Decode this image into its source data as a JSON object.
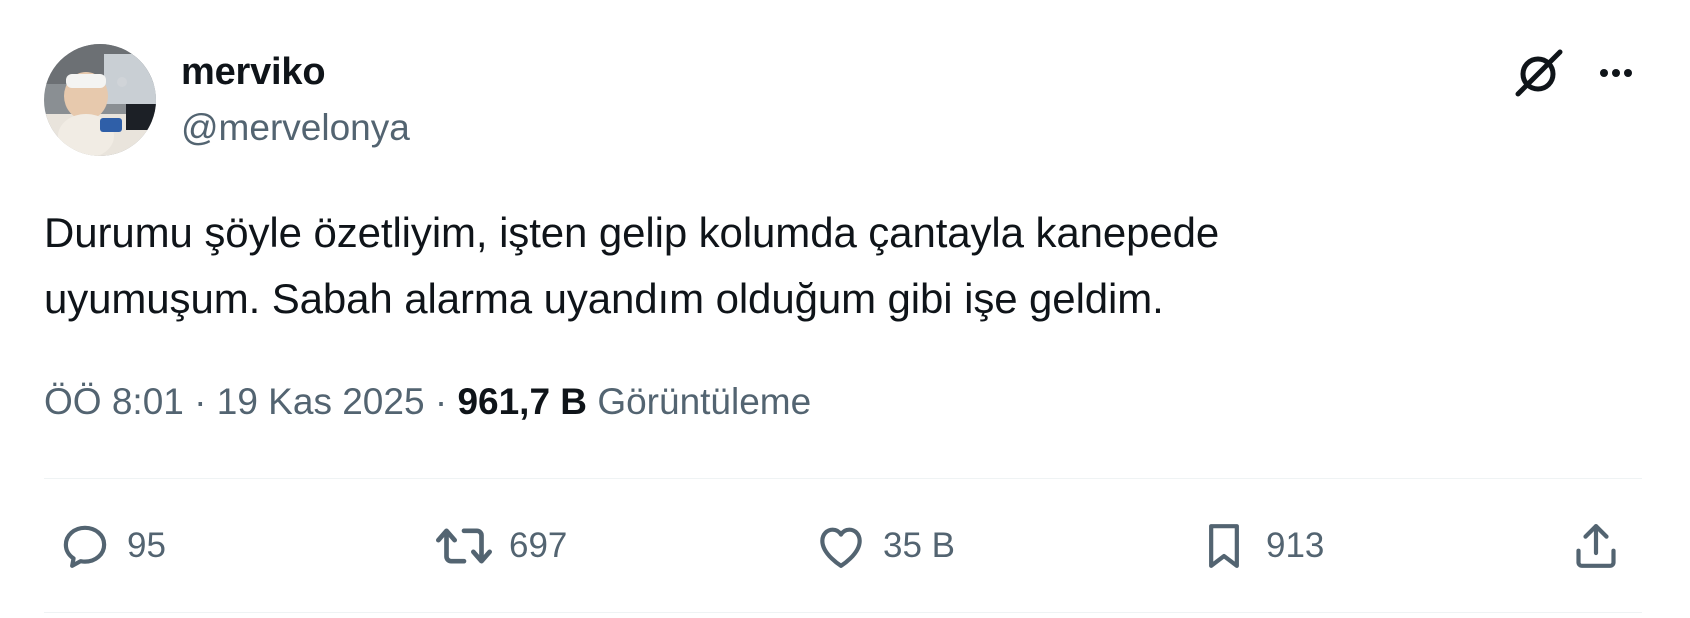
{
  "user": {
    "display_name": "merviko",
    "handle": "@mervelonya",
    "avatar_icon": "avatar-photo"
  },
  "header_icons": {
    "grok": "grok-icon",
    "more": "more-icon"
  },
  "tweet": {
    "line1": "Durumu şöyle özetliyim, işten gelip kolumda çantayla kanepede",
    "line2": "uyumuşum. Sabah alarma uyandım olduğum gibi işe geldim."
  },
  "meta": {
    "time": "ÖÖ 8:01",
    "separator": "·",
    "date": "19 Kas 2025",
    "views_count": "961,7 B",
    "views_label": "Görüntüleme"
  },
  "actions": {
    "reply_count": "95",
    "retweet_count": "697",
    "like_count": "35 B",
    "bookmark_count": "913"
  },
  "colors": {
    "text_primary": "#0f1419",
    "text_secondary": "#536471",
    "divider": "#eff3f4",
    "background": "#ffffff"
  }
}
